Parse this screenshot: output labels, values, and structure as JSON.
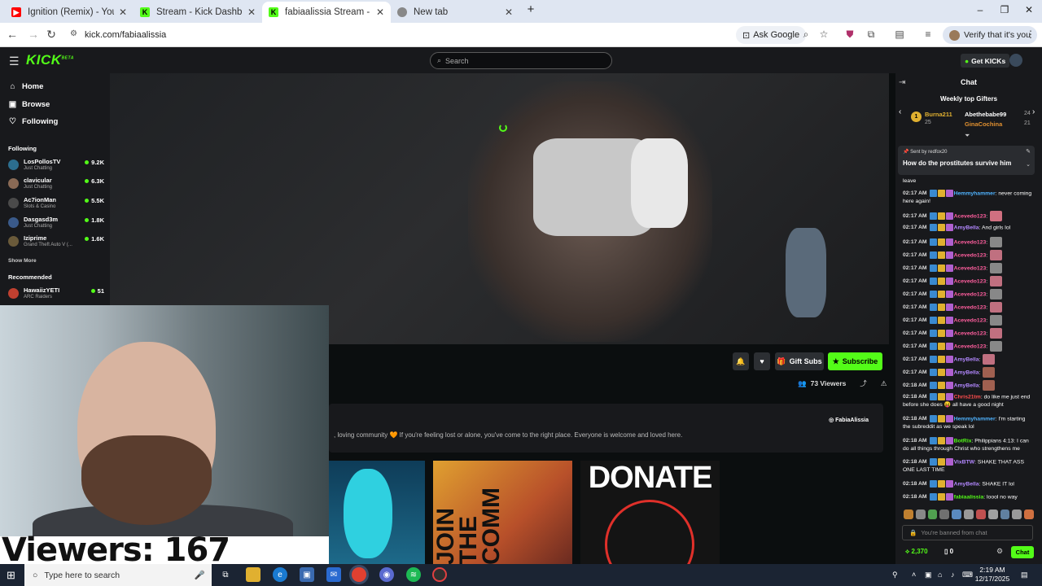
{
  "browser": {
    "tabs": [
      {
        "title": "Ignition (Remix) - YouTube",
        "color": "#ff0000",
        "glyph": "▶"
      },
      {
        "title": "Stream - Kick Dashboard",
        "color": "#53fc18",
        "glyph": "K"
      },
      {
        "title": "fabiaalissia Stream - Watch Live",
        "color": "#53fc18",
        "glyph": "K"
      },
      {
        "title": "New tab",
        "color": "#888888",
        "glyph": "◎"
      }
    ],
    "url": "kick.com/fabiaalissia",
    "ask_google": "Ask Google",
    "verify": "Verify that it's you"
  },
  "kick": {
    "search_placeholder": "Search",
    "get_kicks": "Get KICKs",
    "nav": [
      {
        "label": "Home",
        "icon": "home-icon",
        "glyph": "⌂"
      },
      {
        "label": "Browse",
        "icon": "browse-icon",
        "glyph": "▣"
      },
      {
        "label": "Following",
        "icon": "heart-icon",
        "glyph": "♡"
      }
    ],
    "following_header": "Following",
    "following": [
      {
        "name": "LosPollosTV",
        "category": "Just Chatting",
        "viewers": "9.2K",
        "color": "#2c6e8f"
      },
      {
        "name": "clavicular",
        "category": "Just Chatting",
        "viewers": "6.3K",
        "color": "#8a6a55"
      },
      {
        "name": "Ac7ionMan",
        "category": "Slots & Casino",
        "viewers": "5.5K",
        "color": "#4a4a4a"
      },
      {
        "name": "Dasgasd3m",
        "category": "Just Chatting",
        "viewers": "1.8K",
        "color": "#3a5a8a"
      },
      {
        "name": "Iziprime",
        "category": "Grand Theft Auto V (...",
        "viewers": "1.6K",
        "color": "#6a5a3a"
      }
    ],
    "show_more": "Show More",
    "recommended_header": "Recommended",
    "recommended": [
      {
        "name": "HawaiizYETI",
        "category": "ARC Raiders",
        "viewers": "51",
        "color": "#c04030"
      }
    ],
    "actions": {
      "gift_subs": "Gift Subs",
      "subscribe": "Subscribe"
    },
    "viewers_label": "73 Viewers",
    "about_text": ", loving community 🧡 If you're feeling lost or alone, you've come to the right place. Everyone is welcome and loved here.",
    "instagram": "FabiaAlissia",
    "panels": [
      {
        "label": "",
        "color": "#1d6a8a"
      },
      {
        "label": "JOIN THE COMM",
        "color": "#b8502a"
      },
      {
        "label": "DONATE",
        "color": "#1a1a1a"
      }
    ]
  },
  "webcam": {
    "viewers_overlay": "Viewers: 167"
  },
  "chat": {
    "title": "Chat",
    "weekly_top_gifters": "Weekly top Gifters",
    "gifters": [
      {
        "rank": "1",
        "name": "Burna211",
        "count": "25"
      },
      {
        "name": "Abethebabe99",
        "count": "24"
      },
      {
        "name": "GinaCochina",
        "count": "21"
      }
    ],
    "pinned": {
      "sent_by": "Sent by redfox20",
      "message": "How do the prostitutes survive him"
    },
    "messages": [
      {
        "time": "",
        "user": "",
        "text": "leave",
        "color": "#ffffff"
      },
      {
        "time": "02:17 AM",
        "user": "Hemmyhammer",
        "text": ": never coming here again!",
        "color": "#4fb3ff"
      },
      {
        "time": "02:17 AM",
        "user": "Acevedo123",
        "text": ":",
        "color": "#ff5e9e"
      },
      {
        "time": "02:17 AM",
        "user": "AmyBella",
        "text": ": And girls lol",
        "color": "#b388ff"
      },
      {
        "time": "02:17 AM",
        "user": "Acevedo123",
        "text": ":",
        "color": "#ff5e9e"
      },
      {
        "time": "02:17 AM",
        "user": "Acevedo123",
        "text": ":",
        "color": "#ff5e9e"
      },
      {
        "time": "02:17 AM",
        "user": "Acevedo123",
        "text": ":",
        "color": "#ff5e9e"
      },
      {
        "time": "02:17 AM",
        "user": "Acevedo123",
        "text": ":",
        "color": "#ff5e9e"
      },
      {
        "time": "02:17 AM",
        "user": "Acevedo123",
        "text": ":",
        "color": "#ff5e9e"
      },
      {
        "time": "02:17 AM",
        "user": "Acevedo123",
        "text": ":",
        "color": "#ff5e9e"
      },
      {
        "time": "02:17 AM",
        "user": "Acevedo123",
        "text": ":",
        "color": "#ff5e9e"
      },
      {
        "time": "02:17 AM",
        "user": "Acevedo123",
        "text": ":",
        "color": "#ff5e9e"
      },
      {
        "time": "02:17 AM",
        "user": "Acevedo123",
        "text": ":",
        "color": "#ff5e9e"
      },
      {
        "time": "02:17 AM",
        "user": "AmyBella",
        "text": ":",
        "color": "#b388ff"
      },
      {
        "time": "02:17 AM",
        "user": "AmyBella",
        "text": ":",
        "color": "#b388ff"
      },
      {
        "time": "02:18 AM",
        "user": "AmyBella",
        "text": ":",
        "color": "#b388ff"
      },
      {
        "time": "02:18 AM",
        "user": "Chris21tm",
        "text": ": do like me just end before she does 😝 all have a good night",
        "color": "#ff4d4d"
      },
      {
        "time": "02:18 AM",
        "user": "Hemmyhammer",
        "text": ": I'm starting the subreddit as we speak lol",
        "color": "#4fb3ff"
      },
      {
        "time": "02:18 AM",
        "user": "BotRix",
        "text": ": Philippians 4:13: I can do all things through Christ who strengthens me",
        "color": "#53fc18"
      },
      {
        "time": "02:18 AM",
        "user": "VixBTW",
        "text": ": SHAKE THAT ASS ONE LAST TIME",
        "color": "#b388ff"
      },
      {
        "time": "02:18 AM",
        "user": "AmyBella",
        "text": ": SHAKE IT lol",
        "color": "#b388ff"
      },
      {
        "time": "02:18 AM",
        "user": "fabiaalissia",
        "text": ": loool no way",
        "color": "#53fc18"
      }
    ],
    "banned_placeholder": "You're banned from chat",
    "kicks": "2,370",
    "tickets": "0",
    "send": "Chat"
  },
  "taskbar": {
    "search_placeholder": "Type here to search",
    "time": "2:19 AM",
    "date": "12/17/2025"
  }
}
